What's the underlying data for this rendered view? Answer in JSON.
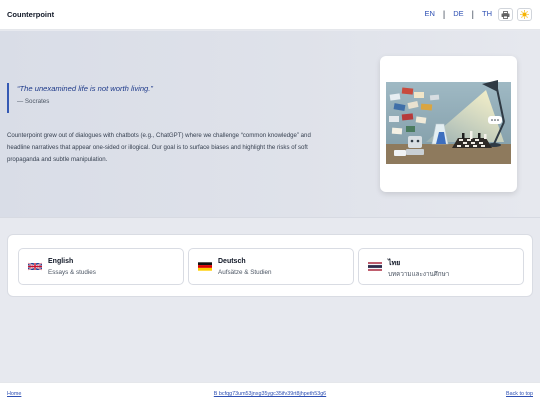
{
  "header": {
    "brand": "Counterpoint",
    "languages": [
      "EN",
      "DE",
      "TH"
    ]
  },
  "hero": {
    "quote": "“The unexamined life is not worth living.”",
    "author": "— Socrates",
    "intro": "Counterpoint grew out of dialogues with chatbots (e.g., ChatGPT) where we challenge “common knowledge” and headline narratives that appear one-sided or illogical. Our goal is to surface biases and highlight the risks of soft propaganda and subtle manipulation."
  },
  "language_cards": [
    {
      "title": "English",
      "subtitle": "Essays & studies",
      "flag": "uk-flag-icon"
    },
    {
      "title": "Deutsch",
      "subtitle": "Aufsätze & Studien",
      "flag": "germany-flag-icon"
    },
    {
      "title": "ไทย",
      "subtitle": "บทความและงานศึกษา",
      "flag": "thailand-flag-icon"
    }
  ],
  "footer": {
    "home": "Home",
    "hash": "B bcfqg73um53jnxg35ygc35ifv39rt8jhpeth53g6",
    "back_to_top": "Back to top"
  },
  "colors": {
    "accent": "#3559b4",
    "link": "#2d4fb3"
  }
}
